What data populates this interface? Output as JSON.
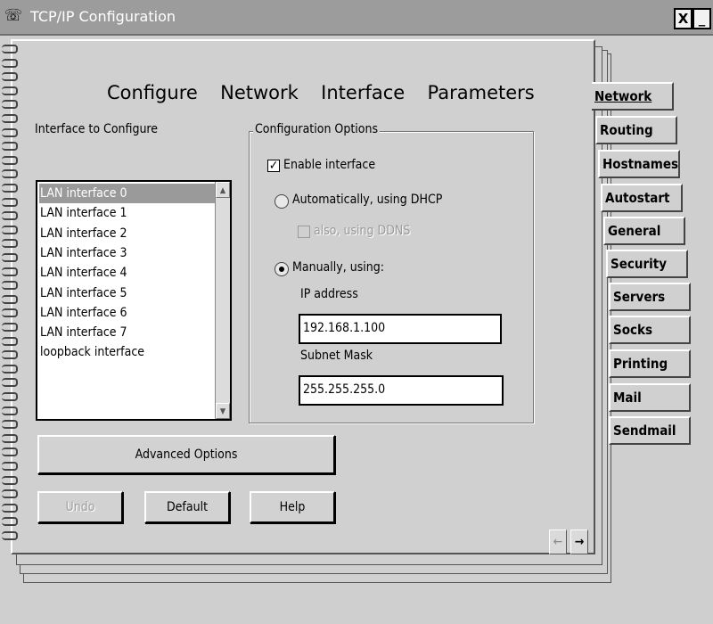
{
  "window": {
    "title": "TCP/IP Configuration",
    "close_label": "X",
    "minimize_label": "_",
    "app_icon": "tcpip-app-icon"
  },
  "page": {
    "heading": "Configure  Network  Interface  Parameters",
    "interface_label": "Interface to Configure",
    "interfaces": [
      "LAN interface 0",
      "LAN interface 1",
      "LAN interface 2",
      "LAN interface 3",
      "LAN interface 4",
      "LAN interface 5",
      "LAN interface 6",
      "LAN interface 7",
      "loopback interface"
    ],
    "selected_interface": "LAN interface 0"
  },
  "config": {
    "group_title": "Configuration Options",
    "enable_label": "Enable interface",
    "enable_checked": true,
    "dhcp_label": "Automatically, using DHCP",
    "ddns_label": "also, using DDNS",
    "manual_label": "Manually, using:",
    "ip_label": "IP address",
    "ip_value": "192.168.1.100",
    "mask_label": "Subnet Mask",
    "mask_value": "255.255.255.0"
  },
  "buttons": {
    "advanced": "Advanced Options",
    "undo": "Undo",
    "default": "Default",
    "help": "Help"
  },
  "tabs": [
    "Network",
    "Routing",
    "Hostnames",
    "Autostart",
    "General",
    "Security",
    "Servers",
    "Socks",
    "Printing",
    "Mail",
    "Sendmail"
  ],
  "nav": {
    "prev_icon": "left-arrow-icon",
    "next_icon": "right-arrow-icon",
    "prev_label": "←",
    "next_label": "→"
  }
}
